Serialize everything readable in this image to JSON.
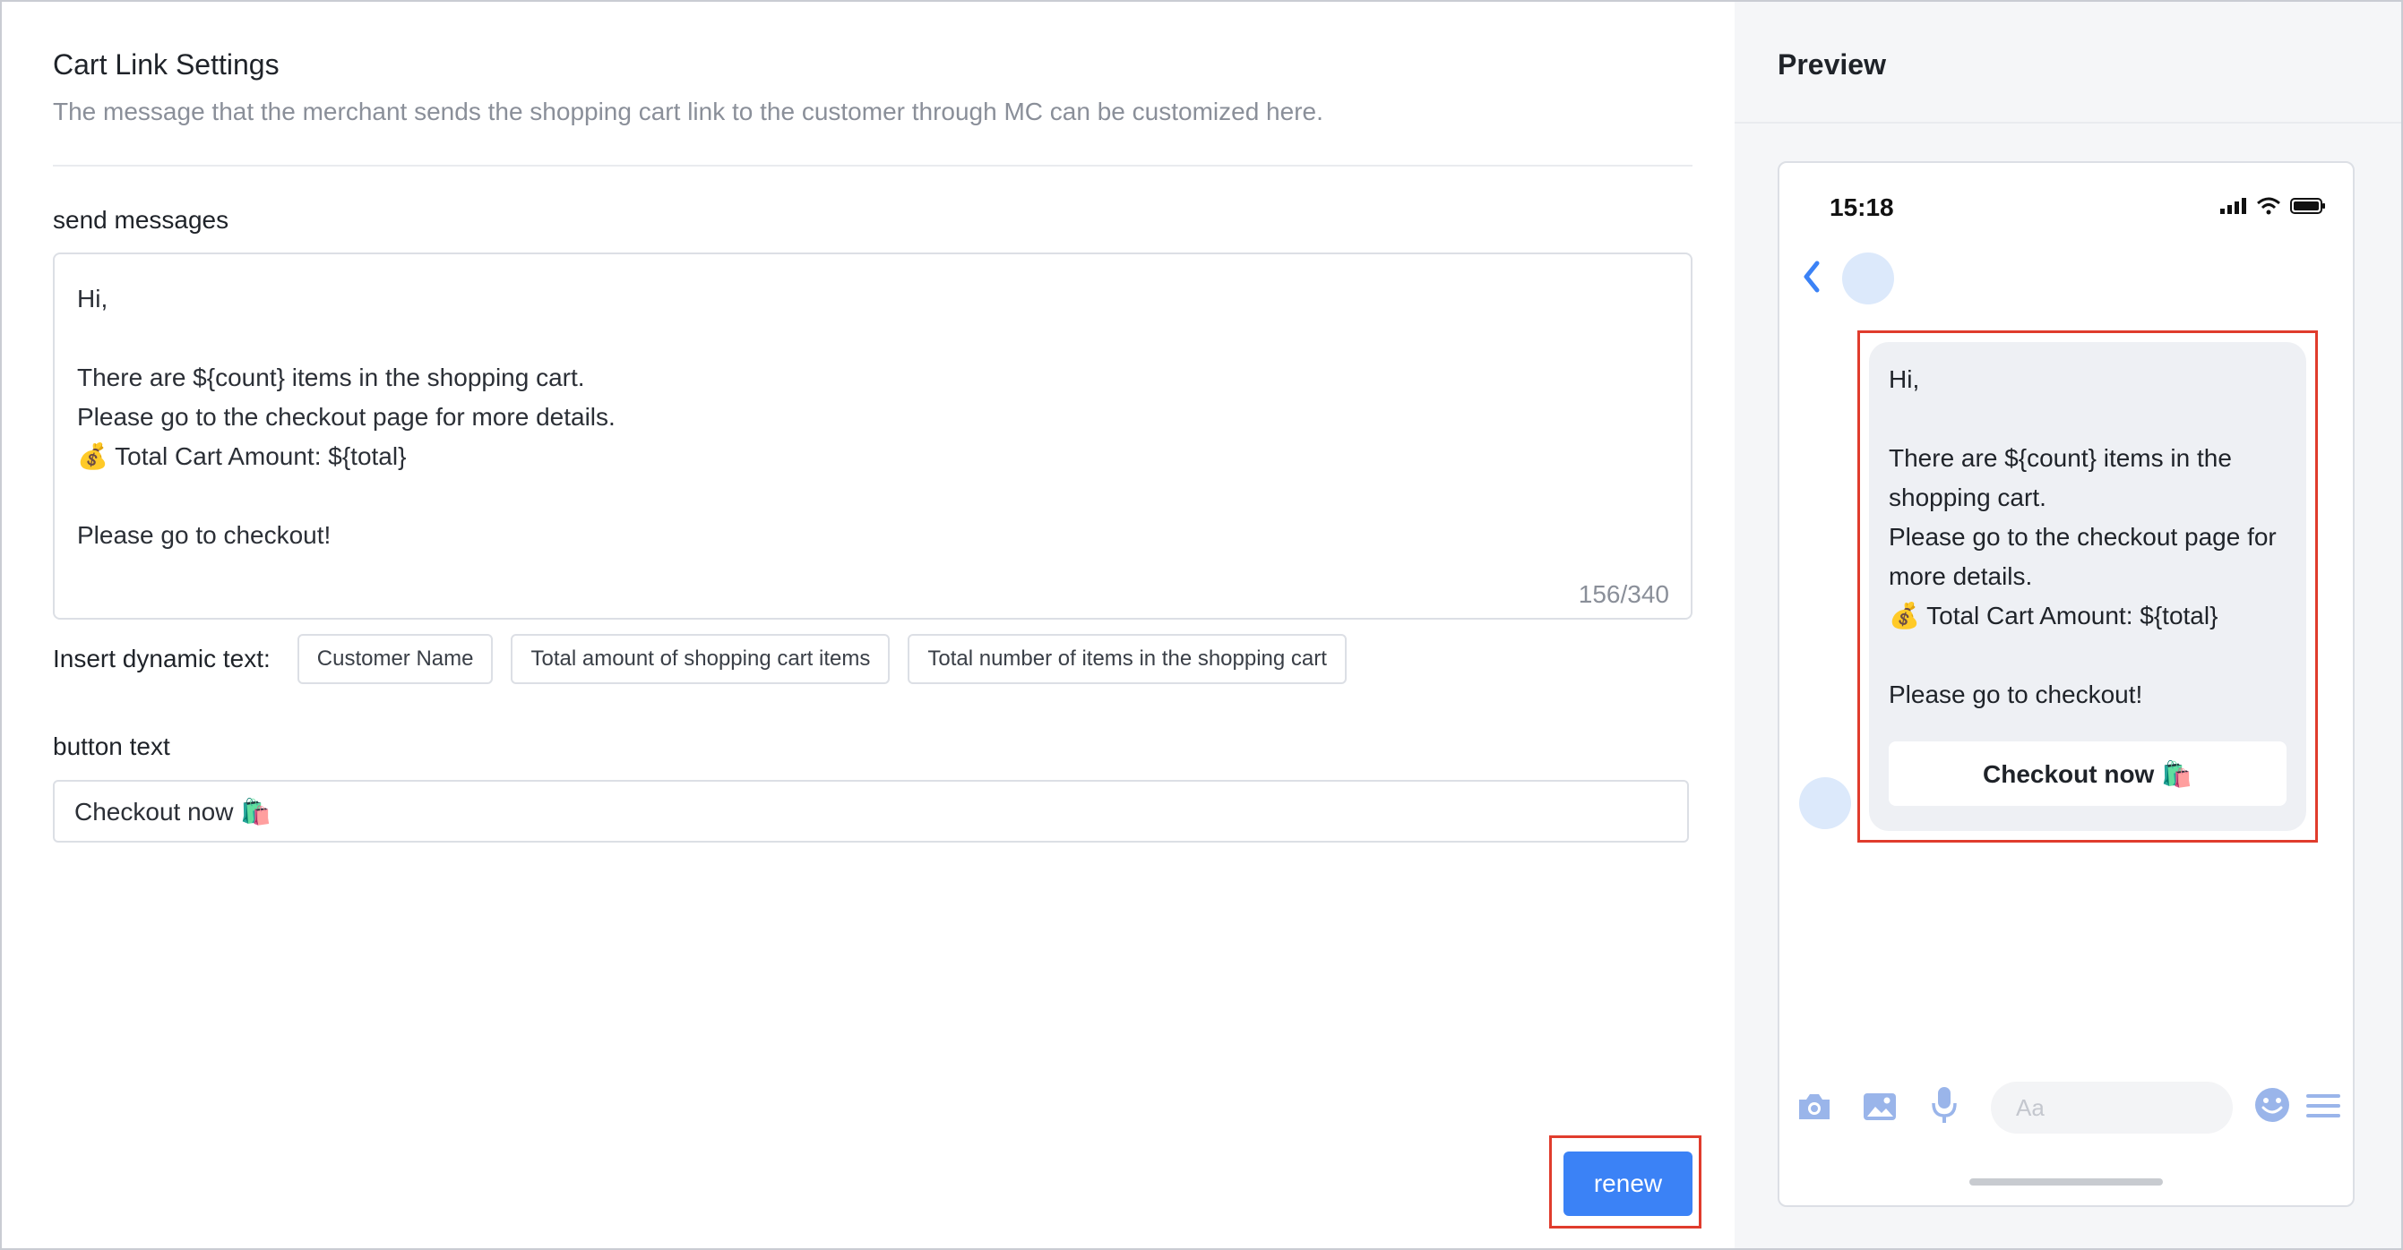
{
  "settings": {
    "title": "Cart Link Settings",
    "description": "The message that the merchant sends the shopping cart link to the customer through MC can be customized here.",
    "send_messages_label": "send messages",
    "message_text": "Hi,\n\nThere are ${count} items in the shopping cart.\nPlease go to the checkout page for more details.\n💰 Total Cart Amount: ${total}\n\nPlease go to checkout!",
    "message_counter": "156/340",
    "insert_dynamic_label": "Insert dynamic text:",
    "dynamic_tags": [
      "Customer Name",
      "Total amount of shopping cart items",
      "Total number of items in the shopping cart"
    ],
    "button_text_label": "button text",
    "button_text_value": "Checkout now 🛍️",
    "renew_label": "renew"
  },
  "preview": {
    "title": "Preview",
    "status_time": "15:18",
    "bubble_text": "Hi,\n\nThere are ${count} items in the shopping cart.\nPlease go to the checkout page for more details.\n💰 Total Cart Amount: ${total}\n\nPlease go to checkout!",
    "bubble_button": "Checkout now 🛍️",
    "composer_placeholder": "Aa",
    "icons": [
      "camera-icon",
      "image-icon",
      "microphone-icon",
      "emoji-icon",
      "menu-icon",
      "back-chevron-icon",
      "signal-icon",
      "wifi-icon",
      "battery-icon"
    ]
  },
  "colors": {
    "accent": "#3b82f6",
    "highlight": "#e03c2d",
    "preview_icon": "#9ab5ea"
  }
}
